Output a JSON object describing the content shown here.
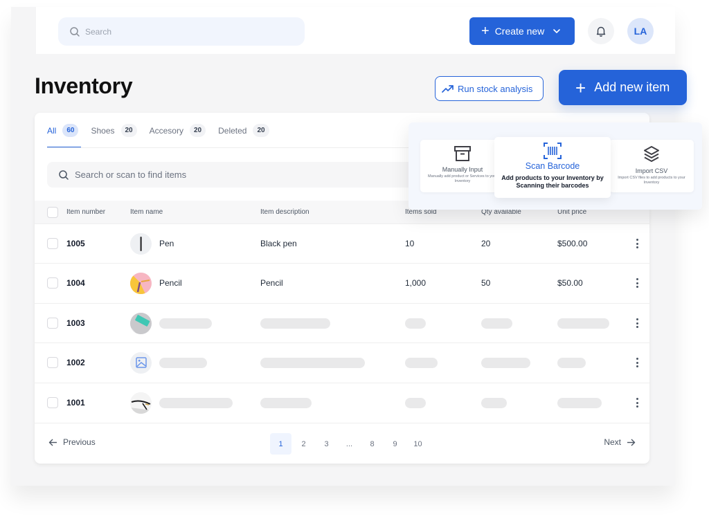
{
  "header": {
    "search_placeholder": "Search",
    "create_new_label": "Create new",
    "avatar_initials": "LA"
  },
  "page": {
    "title": "Inventory",
    "run_analysis_label": "Run stock analysis",
    "add_item_label": "Add new item"
  },
  "tabs": [
    {
      "label": "All",
      "count": "60",
      "active": true
    },
    {
      "label": "Shoes",
      "count": "20",
      "active": false
    },
    {
      "label": "Accesory",
      "count": "20",
      "active": false
    },
    {
      "label": "Deleted",
      "count": "20",
      "active": false
    }
  ],
  "item_search": {
    "placeholder": "Search or scan to find items"
  },
  "table": {
    "columns": [
      "Item number",
      "Item name",
      "Item description",
      "Items sold",
      "Qty available",
      "Unit price"
    ],
    "rows": [
      {
        "number": "1005",
        "name": "Pen",
        "description": "Black pen",
        "sold": "10",
        "qty": "20",
        "price": "$500.00",
        "thumb": "pen-image",
        "loading": false
      },
      {
        "number": "1004",
        "name": "Pencil",
        "description": "Pencil",
        "sold": "1,000",
        "qty": "50",
        "price": "$50.00",
        "thumb": "pencil-image",
        "loading": false
      },
      {
        "number": "1003",
        "thumb": "eraser-image",
        "loading": true
      },
      {
        "number": "1002",
        "thumb": "image-placeholder-icon",
        "loading": true
      },
      {
        "number": "1001",
        "thumb": "glasses-image",
        "loading": true
      }
    ]
  },
  "pagination": {
    "previous_label": "Previous",
    "next_label": "Next",
    "pages": [
      "1",
      "2",
      "3",
      "...",
      "8",
      "9",
      "10"
    ],
    "current": "1"
  },
  "add_options": {
    "manual": {
      "title": "Manually Input",
      "description": "Manually add product or Services to your Inventory"
    },
    "scan": {
      "title": "Scan Barcode",
      "description": "Add products to your Inventory by Scanning their barcodes"
    },
    "csv": {
      "title": "Import CSV",
      "description": "Import CSV files to add products to your Inventory"
    }
  },
  "colors": {
    "accent": "#2563d9",
    "background": "#f5f5f6",
    "skeleton": "#e9e9ea"
  }
}
